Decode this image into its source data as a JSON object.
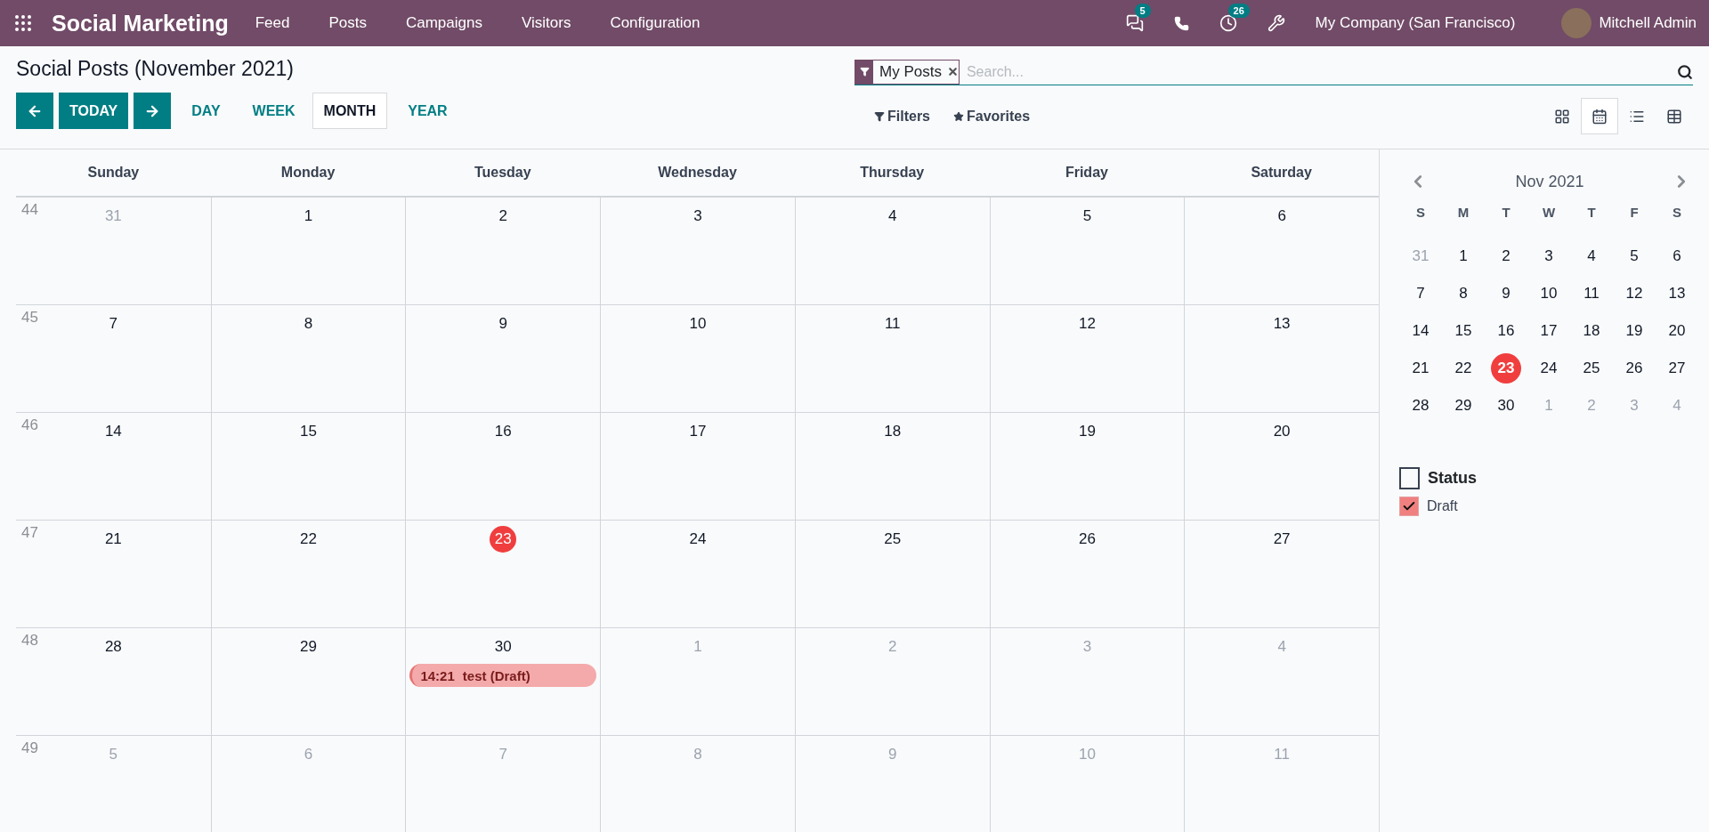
{
  "navbar": {
    "app_name": "Social Marketing",
    "menu": [
      "Feed",
      "Posts",
      "Campaigns",
      "Visitors",
      "Configuration"
    ],
    "messages_count": "5",
    "activities_count": "26",
    "company": "My Company (San Francisco)",
    "user": "Mitchell Admin"
  },
  "page_title": "Social Posts (November 2021)",
  "search": {
    "facet": "My Posts",
    "placeholder": "Search..."
  },
  "nav_buttons": {
    "today": "TODAY"
  },
  "scales": [
    {
      "label": "DAY",
      "selected": false
    },
    {
      "label": "WEEK",
      "selected": false
    },
    {
      "label": "MONTH",
      "selected": true
    },
    {
      "label": "YEAR",
      "selected": false
    }
  ],
  "filter_menus": [
    {
      "kind": "filter",
      "label": "Filters"
    },
    {
      "kind": "favorite",
      "label": "Favorites"
    }
  ],
  "views": [
    {
      "kind": "kanban",
      "selected": false
    },
    {
      "kind": "calendar",
      "selected": true
    },
    {
      "kind": "list",
      "selected": false
    },
    {
      "kind": "pivot",
      "selected": false
    }
  ],
  "weekdays": [
    "Sunday",
    "Monday",
    "Tuesday",
    "Wednesday",
    "Thursday",
    "Friday",
    "Saturday"
  ],
  "weeks": [
    {
      "number": "44",
      "days": [
        {
          "label": "31",
          "other_month": true,
          "today": false
        },
        {
          "label": "1",
          "other_month": false,
          "today": false
        },
        {
          "label": "2",
          "other_month": false,
          "today": false
        },
        {
          "label": "3",
          "other_month": false,
          "today": false
        },
        {
          "label": "4",
          "other_month": false,
          "today": false
        },
        {
          "label": "5",
          "other_month": false,
          "today": false
        },
        {
          "label": "6",
          "other_month": false,
          "today": false
        }
      ]
    },
    {
      "number": "45",
      "days": [
        {
          "label": "7",
          "other_month": false,
          "today": false
        },
        {
          "label": "8",
          "other_month": false,
          "today": false
        },
        {
          "label": "9",
          "other_month": false,
          "today": false
        },
        {
          "label": "10",
          "other_month": false,
          "today": false
        },
        {
          "label": "11",
          "other_month": false,
          "today": false
        },
        {
          "label": "12",
          "other_month": false,
          "today": false
        },
        {
          "label": "13",
          "other_month": false,
          "today": false
        }
      ]
    },
    {
      "number": "46",
      "days": [
        {
          "label": "14",
          "other_month": false,
          "today": false
        },
        {
          "label": "15",
          "other_month": false,
          "today": false
        },
        {
          "label": "16",
          "other_month": false,
          "today": false
        },
        {
          "label": "17",
          "other_month": false,
          "today": false
        },
        {
          "label": "18",
          "other_month": false,
          "today": false
        },
        {
          "label": "19",
          "other_month": false,
          "today": false
        },
        {
          "label": "20",
          "other_month": false,
          "today": false
        }
      ]
    },
    {
      "number": "47",
      "days": [
        {
          "label": "21",
          "other_month": false,
          "today": false
        },
        {
          "label": "22",
          "other_month": false,
          "today": false
        },
        {
          "label": "23",
          "other_month": false,
          "today": true
        },
        {
          "label": "24",
          "other_month": false,
          "today": false
        },
        {
          "label": "25",
          "other_month": false,
          "today": false
        },
        {
          "label": "26",
          "other_month": false,
          "today": false
        },
        {
          "label": "27",
          "other_month": false,
          "today": false
        }
      ]
    },
    {
      "number": "48",
      "days": [
        {
          "label": "28",
          "other_month": false,
          "today": false
        },
        {
          "label": "29",
          "other_month": false,
          "today": false
        },
        {
          "label": "30",
          "other_month": false,
          "today": false,
          "events": [
            {
              "time": "14:21",
              "title": "test (Draft)",
              "color": "#f4aaaa"
            }
          ]
        },
        {
          "label": "1",
          "other_month": true,
          "today": false
        },
        {
          "label": "2",
          "other_month": true,
          "today": false
        },
        {
          "label": "3",
          "other_month": true,
          "today": false
        },
        {
          "label": "4",
          "other_month": true,
          "today": false
        }
      ]
    },
    {
      "number": "49",
      "days": [
        {
          "label": "5",
          "other_month": true,
          "today": false
        },
        {
          "label": "6",
          "other_month": true,
          "today": false
        },
        {
          "label": "7",
          "other_month": true,
          "today": false
        },
        {
          "label": "8",
          "other_month": true,
          "today": false
        },
        {
          "label": "9",
          "other_month": true,
          "today": false
        },
        {
          "label": "10",
          "other_month": true,
          "today": false
        },
        {
          "label": "11",
          "other_month": true,
          "today": false
        }
      ]
    }
  ],
  "mini_calendar": {
    "title": "Nov 2021",
    "weekdays": [
      "S",
      "M",
      "T",
      "W",
      "T",
      "F",
      "S"
    ],
    "days": [
      {
        "label": "31",
        "other_month": true,
        "today": false
      },
      {
        "label": "1",
        "other_month": false,
        "today": false
      },
      {
        "label": "2",
        "other_month": false,
        "today": false
      },
      {
        "label": "3",
        "other_month": false,
        "today": false
      },
      {
        "label": "4",
        "other_month": false,
        "today": false
      },
      {
        "label": "5",
        "other_month": false,
        "today": false
      },
      {
        "label": "6",
        "other_month": false,
        "today": false
      },
      {
        "label": "7",
        "other_month": false,
        "today": false
      },
      {
        "label": "8",
        "other_month": false,
        "today": false
      },
      {
        "label": "9",
        "other_month": false,
        "today": false
      },
      {
        "label": "10",
        "other_month": false,
        "today": false
      },
      {
        "label": "11",
        "other_month": false,
        "today": false
      },
      {
        "label": "12",
        "other_month": false,
        "today": false
      },
      {
        "label": "13",
        "other_month": false,
        "today": false
      },
      {
        "label": "14",
        "other_month": false,
        "today": false
      },
      {
        "label": "15",
        "other_month": false,
        "today": false
      },
      {
        "label": "16",
        "other_month": false,
        "today": false
      },
      {
        "label": "17",
        "other_month": false,
        "today": false
      },
      {
        "label": "18",
        "other_month": false,
        "today": false
      },
      {
        "label": "19",
        "other_month": false,
        "today": false
      },
      {
        "label": "20",
        "other_month": false,
        "today": false
      },
      {
        "label": "21",
        "other_month": false,
        "today": false
      },
      {
        "label": "22",
        "other_month": false,
        "today": false
      },
      {
        "label": "23",
        "other_month": false,
        "today": true
      },
      {
        "label": "24",
        "other_month": false,
        "today": false
      },
      {
        "label": "25",
        "other_month": false,
        "today": false
      },
      {
        "label": "26",
        "other_month": false,
        "today": false
      },
      {
        "label": "27",
        "other_month": false,
        "today": false
      },
      {
        "label": "28",
        "other_month": false,
        "today": false
      },
      {
        "label": "29",
        "other_month": false,
        "today": false
      },
      {
        "label": "30",
        "other_month": false,
        "today": false
      },
      {
        "label": "1",
        "other_month": true,
        "today": false
      },
      {
        "label": "2",
        "other_month": true,
        "today": false
      },
      {
        "label": "3",
        "other_month": true,
        "today": false
      },
      {
        "label": "4",
        "other_month": true,
        "today": false
      }
    ]
  },
  "filter_section": {
    "title": "Status",
    "checked": false,
    "items": [
      {
        "label": "Draft",
        "checked": true,
        "color": "#f08080"
      }
    ]
  }
}
